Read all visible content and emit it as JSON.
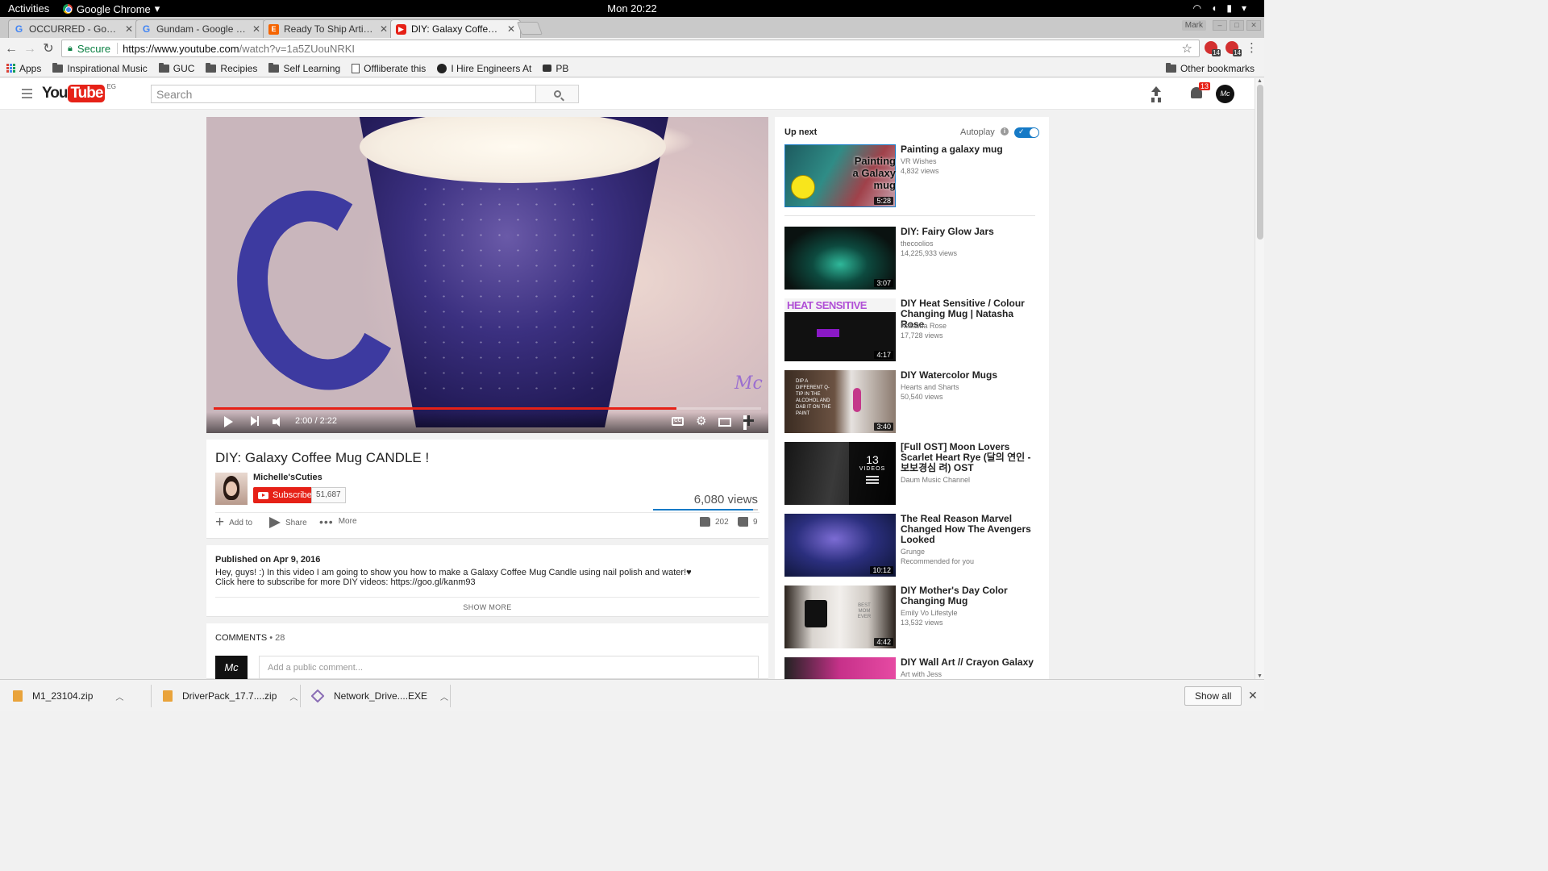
{
  "system": {
    "activities": "Activities",
    "app_name": "Google Chrome",
    "clock": "Mon 20:22"
  },
  "tabs": [
    {
      "title": "OCCURRED - Google",
      "icon": "google-icon"
    },
    {
      "title": "Gundam - Google Se",
      "icon": "google-icon"
    },
    {
      "title": "Ready To Ship Artisan",
      "icon": "etsy-icon"
    },
    {
      "title": "DIY: Galaxy Coffee M",
      "icon": "youtube-icon",
      "active": true
    }
  ],
  "window": {
    "user": "Mark"
  },
  "omnibox": {
    "secure_label": "Secure",
    "url_host": "https://www.youtube.com",
    "url_path": "/watch?v=1a5ZUouNRKI"
  },
  "extensions": {
    "badge_1": "14",
    "badge_2": "14"
  },
  "bookmarks": {
    "items": [
      "Apps",
      "Inspirational Music",
      "GUC",
      "Recipies",
      "Self Learning",
      "Offliberate this",
      "I Hire Engineers At",
      "PB"
    ],
    "other": "Other bookmarks"
  },
  "youtube": {
    "logo_you": "You",
    "logo_tube": "Tube",
    "country": "EG",
    "search_placeholder": "Search",
    "notification_count": "13",
    "account_initials": "Mc"
  },
  "player": {
    "time": "2:00 / 2:22",
    "progress_fraction": 0.845,
    "buffered_fraction": 0.88,
    "watermark": "Mc"
  },
  "video": {
    "title": "DIY: Galaxy Coffee Mug CANDLE !",
    "channel": "Michelle'sCuties",
    "subscribe_label": "Subscribe",
    "subscriber_count": "51,687",
    "views": "6,080 views",
    "actions": {
      "add_to": "Add to",
      "share": "Share",
      "more": "More"
    },
    "likes": "202",
    "dislikes": "9",
    "like_fraction": 0.957
  },
  "description": {
    "published": "Published on Apr 9, 2016",
    "line1": "Hey, guys! :) In this video I am going to show you how to make a Galaxy Coffee Mug Candle using nail polish and water!♥",
    "line2": "Click here to subscribe for more DIY videos: https://goo.gl/kanm93",
    "show_more": "SHOW MORE"
  },
  "comments": {
    "label": "Comments",
    "count": "• 28",
    "placeholder": "Add a public comment...",
    "avatar_text": "Mc"
  },
  "sidebar": {
    "up_next": "Up next",
    "autoplay": "Autoplay",
    "recommendations": [
      {
        "title": "Painting a galaxy mug",
        "channel": "VR Wishes",
        "views": "4,832 views",
        "duration": "5:28",
        "thumb_text": "Painting a Galaxy mug"
      },
      {
        "title": "DIY: Fairy Glow Jars",
        "channel": "thecoolios",
        "views": "14,225,933 views",
        "duration": "3:07"
      },
      {
        "title": "DIY Heat Sensitive / Colour Changing Mug | Natasha Rose",
        "channel": "Natasha Rose",
        "views": "17,728 views",
        "duration": "4:17",
        "thumb_text": "HEAT SENSITIVE"
      },
      {
        "title": "DIY Watercolor Mugs",
        "channel": "Hearts and Sharts",
        "views": "50,540 views",
        "duration": "3:40",
        "thumb_text": "DIP A DIFFERENT Q-TIP IN THE ALCOHOL AND DAB IT ON THE PAINT"
      },
      {
        "title": "[Full OST] Moon Lovers Scarlet Heart Rye (달의 연인 - 보보경심 려) OST",
        "channel": "Daum Music Channel",
        "views": "",
        "playlist_count": "13",
        "playlist_label": "VIDEOS"
      },
      {
        "title": "The Real Reason Marvel Changed How The Avengers Looked",
        "channel": "Grunge",
        "views": "Recommended for you",
        "duration": "10:12"
      },
      {
        "title": "DIY Mother's Day Color Changing Mug",
        "channel": "Emily Vo Lifestyle",
        "views": "13,532 views",
        "duration": "4:42",
        "thumb_text": "BEST MOM EVER"
      },
      {
        "title": "DIY Wall Art // Crayon Galaxy",
        "channel": "Art with Jess",
        "views": ""
      }
    ]
  },
  "downloads": {
    "items": [
      {
        "name": "M1_23104.zip"
      },
      {
        "name": "DriverPack_17.7....zip"
      },
      {
        "name": "Network_Drive....EXE"
      }
    ],
    "show_all": "Show all"
  },
  "colors": {
    "youtube_red": "#e62117",
    "youtube_blue": "#167ac6",
    "secure_green": "#0b8043"
  }
}
